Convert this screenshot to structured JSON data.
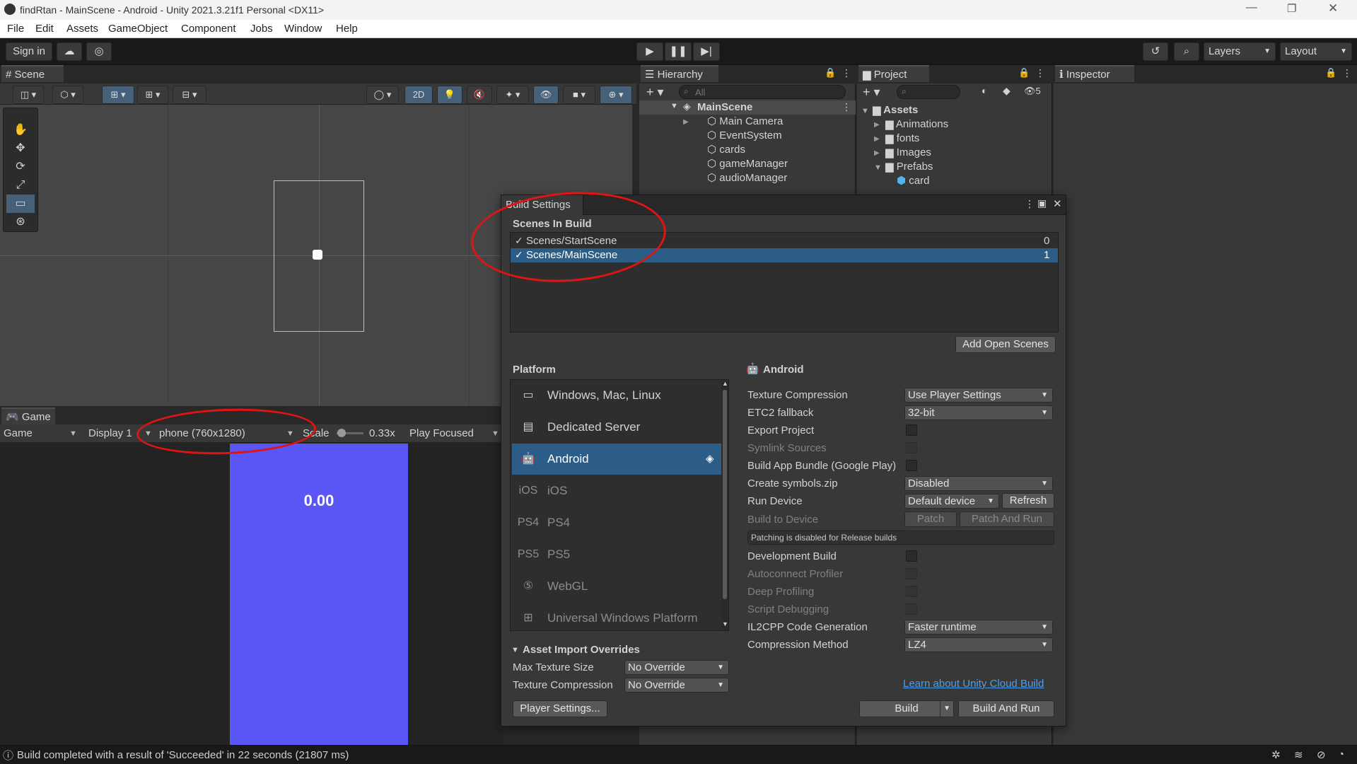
{
  "window": {
    "title": "findRtan - MainScene - Android - Unity 2021.3.21f1 Personal <DX11>"
  },
  "menu": [
    "File",
    "Edit",
    "Assets",
    "GameObject",
    "Component",
    "Jobs",
    "Window",
    "Help"
  ],
  "toolbar": {
    "sign_in": "Sign in",
    "layers": "Layers",
    "layout": "Layout"
  },
  "scene": {
    "tab": "Scene",
    "mode_2d": "2D"
  },
  "game": {
    "tab": "Game",
    "view_select": "Game",
    "display": "Display 1",
    "resolution": "phone (760x1280)",
    "scale_label": "Scale",
    "scale_value": "0.33x",
    "play_mode": "Play Focused",
    "score": "0.00"
  },
  "hierarchy": {
    "tab": "Hierarchy",
    "search_placeholder": "All",
    "scene_name": "MainScene",
    "items": [
      "Main Camera",
      "EventSystem",
      "cards",
      "gameManager",
      "audioManager"
    ]
  },
  "project": {
    "tab": "Project",
    "hidden_count": "5",
    "root": "Assets",
    "folders": [
      "Animations",
      "fonts",
      "Images",
      "Prefabs"
    ],
    "prefab_items": [
      "card"
    ]
  },
  "inspector": {
    "tab": "Inspector"
  },
  "build_settings": {
    "title": "Build Settings",
    "scenes_header": "Scenes In Build",
    "scenes": [
      {
        "name": "Scenes/StartScene",
        "index": "0",
        "checked": true
      },
      {
        "name": "Scenes/MainScene",
        "index": "1",
        "checked": true
      }
    ],
    "add_open_scenes": "Add Open Scenes",
    "platform_header": "Platform",
    "platforms": [
      {
        "name": "Windows, Mac, Linux",
        "icon": "monitor-icon"
      },
      {
        "name": "Dedicated Server",
        "icon": "server-icon"
      },
      {
        "name": "Android",
        "icon": "android-icon"
      },
      {
        "name": "iOS",
        "icon": "ios-icon"
      },
      {
        "name": "PS4",
        "icon": "ps4-icon"
      },
      {
        "name": "PS5",
        "icon": "ps5-icon"
      },
      {
        "name": "WebGL",
        "icon": "html5-icon"
      },
      {
        "name": "Universal Windows Platform",
        "icon": "windows-icon"
      }
    ],
    "selected_platform": "Android",
    "asset_overrides": {
      "header": "Asset Import Overrides",
      "max_texture_label": "Max Texture Size",
      "max_texture_value": "No Override",
      "texture_comp_label": "Texture Compression",
      "texture_comp_value": "No Override"
    },
    "player_settings": "Player Settings...",
    "android": {
      "header": "Android",
      "texture_compression_label": "Texture Compression",
      "texture_compression_value": "Use Player Settings",
      "etc2_label": "ETC2 fallback",
      "etc2_value": "32-bit",
      "export_project": "Export Project",
      "symlink_sources": "Symlink Sources",
      "build_app_bundle": "Build App Bundle (Google Play)",
      "create_symbols_label": "Create symbols.zip",
      "create_symbols_value": "Disabled",
      "run_device_label": "Run Device",
      "run_device_value": "Default device",
      "refresh": "Refresh",
      "build_to_device": "Build to Device",
      "patch": "Patch",
      "patch_and_run": "Patch And Run",
      "patching_note": "Patching is disabled for Release builds",
      "development_build": "Development Build",
      "autoconnect_profiler": "Autoconnect Profiler",
      "deep_profiling": "Deep Profiling",
      "script_debugging": "Script Debugging",
      "il2cpp_label": "IL2CPP Code Generation",
      "il2cpp_value": "Faster runtime",
      "compression_label": "Compression Method",
      "compression_value": "LZ4",
      "cloud_build_link": "Learn about Unity Cloud Build",
      "build": "Build",
      "build_and_run": "Build And Run"
    }
  },
  "status": {
    "message": "Build completed with a result of 'Succeeded' in 22 seconds (21807 ms)"
  },
  "colors": {
    "game_bg": "#5a55f5",
    "selection": "#2c5d87",
    "annotation": "#e01414",
    "link": "#4d9fe9"
  }
}
